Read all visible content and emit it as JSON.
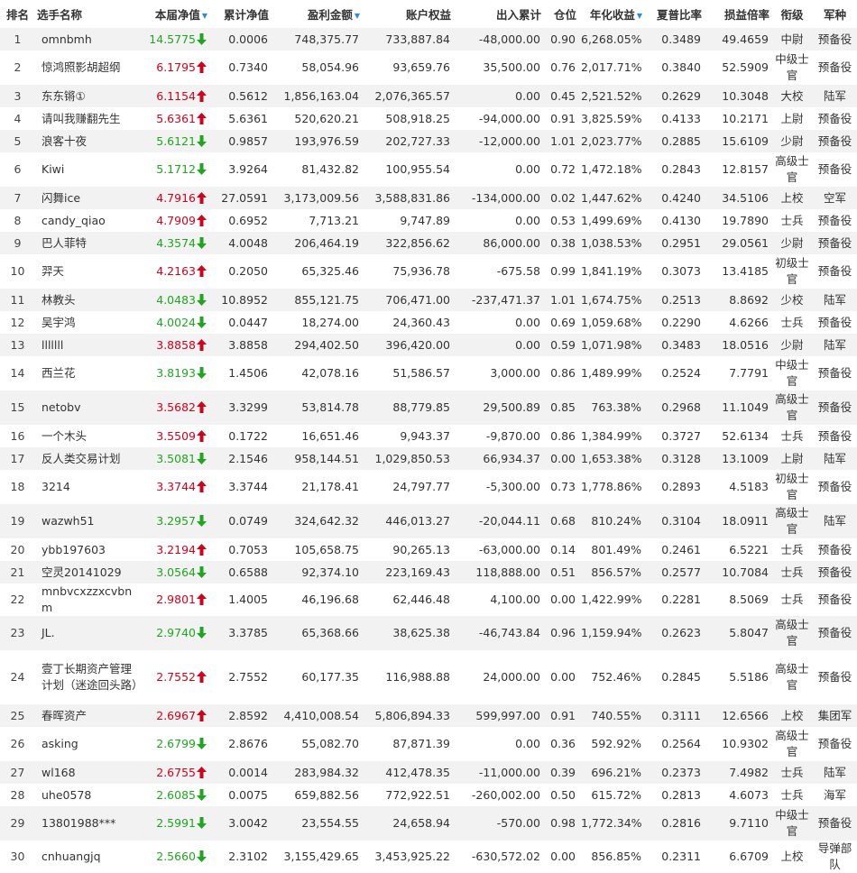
{
  "colors": {
    "up": "#d0021b",
    "down": "#1fa61f",
    "sort_indicator": "#2b8de0",
    "row_alt": "#f2f2f2"
  },
  "headers": {
    "rank": "排名",
    "name": "选手名称",
    "nav": "本届净值",
    "cum_nav": "累计净值",
    "profit": "盈利金额",
    "equity": "账户权益",
    "inout": "出入累计",
    "position": "仓位",
    "annual": "年化收益",
    "sharpe": "夏普比率",
    "pl_ratio": "损益倍率",
    "rank_title": "衔级",
    "army": "军种"
  },
  "sort_icons": {
    "nav": "triangle-down-icon",
    "profit": "triangle-down-icon",
    "annual": "triangle-down-icon"
  },
  "rows": [
    {
      "rank": "1",
      "name": "omnbmh",
      "nav": "14.5775",
      "dir": "down",
      "cum": "0.0006",
      "profit": "748,375.77",
      "equity": "733,887.84",
      "inout": "-48,000.00",
      "pos": "0.90",
      "annual": "6,268.05%",
      "sharpe": "0.3489",
      "pl": "49.4659",
      "title": "中尉",
      "army": "预备役"
    },
    {
      "rank": "2",
      "name": "惊鸿照影胡超纲",
      "nav": "6.1795",
      "dir": "up",
      "cum": "0.7340",
      "profit": "58,054.96",
      "equity": "93,659.76",
      "inout": "35,500.00",
      "pos": "0.76",
      "annual": "2,017.71%",
      "sharpe": "0.3840",
      "pl": "52.5909",
      "title": "中级士官",
      "army": "预备役"
    },
    {
      "rank": "3",
      "name": "东东锵①",
      "nav": "6.1154",
      "dir": "up",
      "cum": "0.5612",
      "profit": "1,856,163.04",
      "equity": "2,076,365.57",
      "inout": "0.00",
      "pos": "0.45",
      "annual": "2,521.52%",
      "sharpe": "0.2629",
      "pl": "10.3048",
      "title": "大校",
      "army": "陆军"
    },
    {
      "rank": "4",
      "name": "请叫我赚翻先生",
      "nav": "5.6361",
      "dir": "up",
      "cum": "5.6361",
      "profit": "520,620.21",
      "equity": "508,918.25",
      "inout": "-94,000.00",
      "pos": "0.91",
      "annual": "3,825.59%",
      "sharpe": "0.4133",
      "pl": "10.2171",
      "title": "上尉",
      "army": "预备役"
    },
    {
      "rank": "5",
      "name": "浪客十夜",
      "nav": "5.6121",
      "dir": "down",
      "cum": "0.9857",
      "profit": "193,976.59",
      "equity": "202,727.33",
      "inout": "-12,000.00",
      "pos": "1.01",
      "annual": "2,023.77%",
      "sharpe": "0.2885",
      "pl": "15.6109",
      "title": "少尉",
      "army": "预备役"
    },
    {
      "rank": "6",
      "name": "Kiwi",
      "nav": "5.1712",
      "dir": "down",
      "cum": "3.9264",
      "profit": "81,432.82",
      "equity": "100,955.54",
      "inout": "0.00",
      "pos": "0.72",
      "annual": "1,472.18%",
      "sharpe": "0.2843",
      "pl": "12.8157",
      "title": "高级士官",
      "army": "预备役"
    },
    {
      "rank": "7",
      "name": "闪舞ice",
      "nav": "4.7916",
      "dir": "up",
      "cum": "27.0591",
      "profit": "3,173,009.56",
      "equity": "3,588,831.86",
      "inout": "-134,000.00",
      "pos": "0.02",
      "annual": "1,447.62%",
      "sharpe": "0.4240",
      "pl": "34.5106",
      "title": "上校",
      "army": "空军"
    },
    {
      "rank": "8",
      "name": "candy_qiao",
      "nav": "4.7909",
      "dir": "up",
      "cum": "0.6952",
      "profit": "7,713.21",
      "equity": "9,747.89",
      "inout": "0.00",
      "pos": "0.53",
      "annual": "1,499.69%",
      "sharpe": "0.4130",
      "pl": "19.7890",
      "title": "士兵",
      "army": "预备役"
    },
    {
      "rank": "9",
      "name": "巴人菲特",
      "nav": "4.3574",
      "dir": "down",
      "cum": "4.0048",
      "profit": "206,464.19",
      "equity": "322,856.62",
      "inout": "86,000.00",
      "pos": "0.38",
      "annual": "1,038.53%",
      "sharpe": "0.2951",
      "pl": "29.0561",
      "title": "少尉",
      "army": "预备役"
    },
    {
      "rank": "10",
      "name": "羿天",
      "nav": "4.2163",
      "dir": "up",
      "cum": "0.2050",
      "profit": "65,325.46",
      "equity": "75,936.78",
      "inout": "-675.58",
      "pos": "0.99",
      "annual": "1,841.19%",
      "sharpe": "0.3073",
      "pl": "13.4185",
      "title": "初级士官",
      "army": "预备役"
    },
    {
      "rank": "11",
      "name": "林教头",
      "nav": "4.0483",
      "dir": "down",
      "cum": "10.8952",
      "profit": "855,121.75",
      "equity": "706,471.00",
      "inout": "-237,471.37",
      "pos": "1.01",
      "annual": "1,674.75%",
      "sharpe": "0.2513",
      "pl": "8.8692",
      "title": "少校",
      "army": "陆军"
    },
    {
      "rank": "12",
      "name": "吴宇鸿",
      "nav": "4.0024",
      "dir": "down",
      "cum": "0.0447",
      "profit": "18,274.00",
      "equity": "24,360.43",
      "inout": "0.00",
      "pos": "0.69",
      "annual": "1,059.68%",
      "sharpe": "0.2290",
      "pl": "4.6266",
      "title": "士兵",
      "army": "预备役"
    },
    {
      "rank": "13",
      "name": "lllllll",
      "nav": "3.8858",
      "dir": "up",
      "cum": "3.8858",
      "profit": "294,402.50",
      "equity": "396,420.00",
      "inout": "0.00",
      "pos": "0.59",
      "annual": "1,071.98%",
      "sharpe": "0.3483",
      "pl": "18.0516",
      "title": "少尉",
      "army": "陆军"
    },
    {
      "rank": "14",
      "name": "西兰花",
      "nav": "3.8193",
      "dir": "down",
      "cum": "1.4506",
      "profit": "42,078.16",
      "equity": "51,586.57",
      "inout": "3,000.00",
      "pos": "0.86",
      "annual": "1,489.99%",
      "sharpe": "0.2524",
      "pl": "7.7791",
      "title": "中级士官",
      "army": "预备役"
    },
    {
      "rank": "15",
      "name": "netobv",
      "nav": "3.5682",
      "dir": "up",
      "cum": "3.3299",
      "profit": "53,814.78",
      "equity": "88,779.85",
      "inout": "29,500.89",
      "pos": "0.85",
      "annual": "763.38%",
      "sharpe": "0.2968",
      "pl": "11.1049",
      "title": "高级士官",
      "army": "预备役"
    },
    {
      "rank": "16",
      "name": "一个木头",
      "nav": "3.5509",
      "dir": "up",
      "cum": "0.1722",
      "profit": "16,651.46",
      "equity": "9,943.37",
      "inout": "-9,870.00",
      "pos": "0.86",
      "annual": "1,384.99%",
      "sharpe": "0.3727",
      "pl": "52.6134",
      "title": "士兵",
      "army": "预备役"
    },
    {
      "rank": "17",
      "name": "反人类交易计划",
      "nav": "3.5081",
      "dir": "down",
      "cum": "2.1546",
      "profit": "958,144.51",
      "equity": "1,029,850.53",
      "inout": "66,934.37",
      "pos": "0.00",
      "annual": "1,653.38%",
      "sharpe": "0.3128",
      "pl": "13.1009",
      "title": "上尉",
      "army": "陆军"
    },
    {
      "rank": "18",
      "name": "3214",
      "nav": "3.3744",
      "dir": "up",
      "cum": "3.3744",
      "profit": "21,178.41",
      "equity": "24,797.77",
      "inout": "-5,300.00",
      "pos": "0.73",
      "annual": "1,778.86%",
      "sharpe": "0.2893",
      "pl": "4.5183",
      "title": "初级士官",
      "army": "预备役"
    },
    {
      "rank": "19",
      "name": "wazwh51",
      "nav": "3.2957",
      "dir": "down",
      "cum": "0.0749",
      "profit": "324,642.32",
      "equity": "446,013.27",
      "inout": "-20,044.11",
      "pos": "0.68",
      "annual": "810.24%",
      "sharpe": "0.3104",
      "pl": "18.0911",
      "title": "高级士官",
      "army": "陆军"
    },
    {
      "rank": "20",
      "name": "ybb197603",
      "nav": "3.2194",
      "dir": "up",
      "cum": "0.7053",
      "profit": "105,658.75",
      "equity": "90,265.13",
      "inout": "-63,000.00",
      "pos": "0.14",
      "annual": "801.49%",
      "sharpe": "0.2461",
      "pl": "6.5221",
      "title": "士兵",
      "army": "预备役"
    },
    {
      "rank": "21",
      "name": "空灵20141029",
      "nav": "3.0564",
      "dir": "down",
      "cum": "0.6588",
      "profit": "92,374.10",
      "equity": "223,169.43",
      "inout": "118,888.00",
      "pos": "0.51",
      "annual": "856.57%",
      "sharpe": "0.2577",
      "pl": "10.7084",
      "title": "士兵",
      "army": "预备役"
    },
    {
      "rank": "22",
      "name": "mnbvcxzzxcvbnm",
      "nav": "2.9801",
      "dir": "up",
      "cum": "1.4005",
      "profit": "46,196.68",
      "equity": "62,446.48",
      "inout": "4,100.00",
      "pos": "0.00",
      "annual": "1,422.99%",
      "sharpe": "0.2281",
      "pl": "8.5069",
      "title": "士兵",
      "army": "预备役"
    },
    {
      "rank": "23",
      "name": "JL.",
      "nav": "2.9740",
      "dir": "down",
      "cum": "3.3785",
      "profit": "65,368.66",
      "equity": "38,625.38",
      "inout": "-46,743.84",
      "pos": "0.96",
      "annual": "1,159.94%",
      "sharpe": "0.2623",
      "pl": "5.8047",
      "title": "高级士官",
      "army": "预备役"
    },
    {
      "rank": "24",
      "name": "壹丁长期资产管理计划（迷途回头路）",
      "nav": "2.7552",
      "dir": "up",
      "cum": "2.7552",
      "profit": "60,177.35",
      "equity": "116,988.88",
      "inout": "24,000.00",
      "pos": "0.00",
      "annual": "752.46%",
      "sharpe": "0.2845",
      "pl": "5.5186",
      "title": "高级士官",
      "army": "预备役"
    },
    {
      "rank": "25",
      "name": "春晖资产",
      "nav": "2.6967",
      "dir": "up",
      "cum": "2.8592",
      "profit": "4,410,008.54",
      "equity": "5,806,894.33",
      "inout": "599,997.00",
      "pos": "0.91",
      "annual": "740.55%",
      "sharpe": "0.3111",
      "pl": "12.6566",
      "title": "上校",
      "army": "集团军"
    },
    {
      "rank": "26",
      "name": "asking",
      "nav": "2.6799",
      "dir": "down",
      "cum": "2.8676",
      "profit": "55,082.70",
      "equity": "87,871.39",
      "inout": "0.00",
      "pos": "0.36",
      "annual": "592.92%",
      "sharpe": "0.2564",
      "pl": "10.9302",
      "title": "高级士官",
      "army": "预备役"
    },
    {
      "rank": "27",
      "name": "wl168",
      "nav": "2.6755",
      "dir": "up",
      "cum": "0.0014",
      "profit": "283,984.32",
      "equity": "412,478.35",
      "inout": "-11,000.00",
      "pos": "0.39",
      "annual": "696.21%",
      "sharpe": "0.2373",
      "pl": "7.4982",
      "title": "士兵",
      "army": "陆军"
    },
    {
      "rank": "28",
      "name": "uhe0578",
      "nav": "2.6085",
      "dir": "down",
      "cum": "0.0075",
      "profit": "659,882.56",
      "equity": "772,922.51",
      "inout": "-260,002.00",
      "pos": "0.50",
      "annual": "615.72%",
      "sharpe": "0.2813",
      "pl": "4.6073",
      "title": "士兵",
      "army": "海军"
    },
    {
      "rank": "29",
      "name": "13801988***",
      "nav": "2.5991",
      "dir": "down",
      "cum": "3.0042",
      "profit": "23,554.55",
      "equity": "24,658.94",
      "inout": "-570.00",
      "pos": "0.98",
      "annual": "1,772.34%",
      "sharpe": "0.2816",
      "pl": "9.7110",
      "title": "中级士官",
      "army": "预备役"
    },
    {
      "rank": "30",
      "name": "cnhuangjq",
      "nav": "2.5660",
      "dir": "down",
      "cum": "2.3102",
      "profit": "3,155,429.65",
      "equity": "3,453,925.22",
      "inout": "-630,572.02",
      "pos": "0.00",
      "annual": "856.85%",
      "sharpe": "0.2311",
      "pl": "6.6709",
      "title": "上校",
      "army": "导弹部队"
    }
  ]
}
